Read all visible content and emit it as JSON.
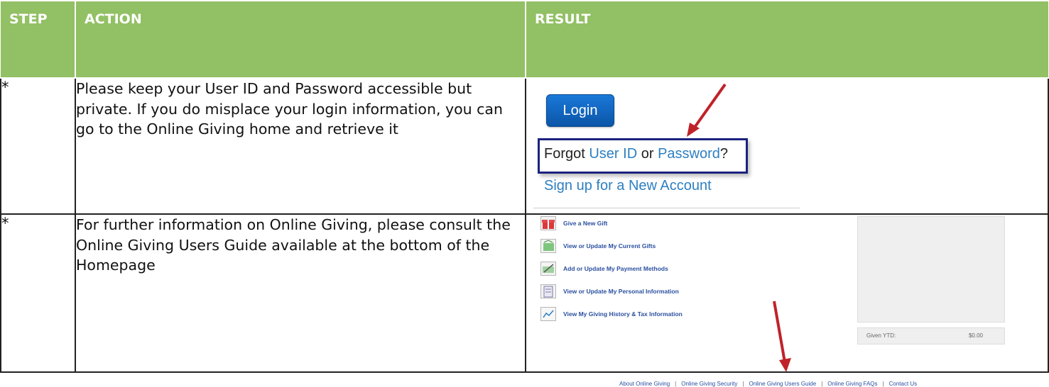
{
  "headers": {
    "step": "STEP",
    "action": "ACTION",
    "result": "RESULT"
  },
  "rows": [
    {
      "step": "*",
      "action": "Please keep your User ID and Password accessible but private.  If you do misplace your login information, you can go to the Online Giving home and retrieve it",
      "result": {
        "login_button": "Login",
        "forgot_prefix": "Forgot ",
        "forgot_user_id": "User ID",
        "forgot_or": " or ",
        "forgot_password": "Password",
        "forgot_q": "?",
        "signup": "Sign up for a New Account",
        "arrow_color": "#c0222a"
      }
    },
    {
      "step": "*",
      "action": "For further information on Online Giving, please consult the Online Giving Users Guide available at the bottom of the Homepage",
      "result": {
        "menu": [
          {
            "label": "Give a New Gift",
            "icon": "gift-icon"
          },
          {
            "label": "View or Update My Current Gifts",
            "icon": "gifts-money-icon"
          },
          {
            "label": "Add or Update My Payment Methods",
            "icon": "payment-check-icon"
          },
          {
            "label": "View or Update My Personal Information",
            "icon": "personal-info-icon"
          },
          {
            "label": "View My Giving History & Tax Information",
            "icon": "history-chart-icon"
          }
        ],
        "ytd_label": "Given YTD:",
        "ytd_value": "$0.00",
        "footer": [
          "About Online Giving",
          "Online Giving Security",
          "Online Giving Users Guide",
          "Online Giving FAQs",
          "Contact Us"
        ],
        "footer_separator": "|"
      }
    }
  ],
  "colors": {
    "header_bg": "#92c064",
    "link_blue": "#2d7fc1",
    "menu_blue": "#2a4fa0",
    "arrow_red": "#c0222a"
  }
}
